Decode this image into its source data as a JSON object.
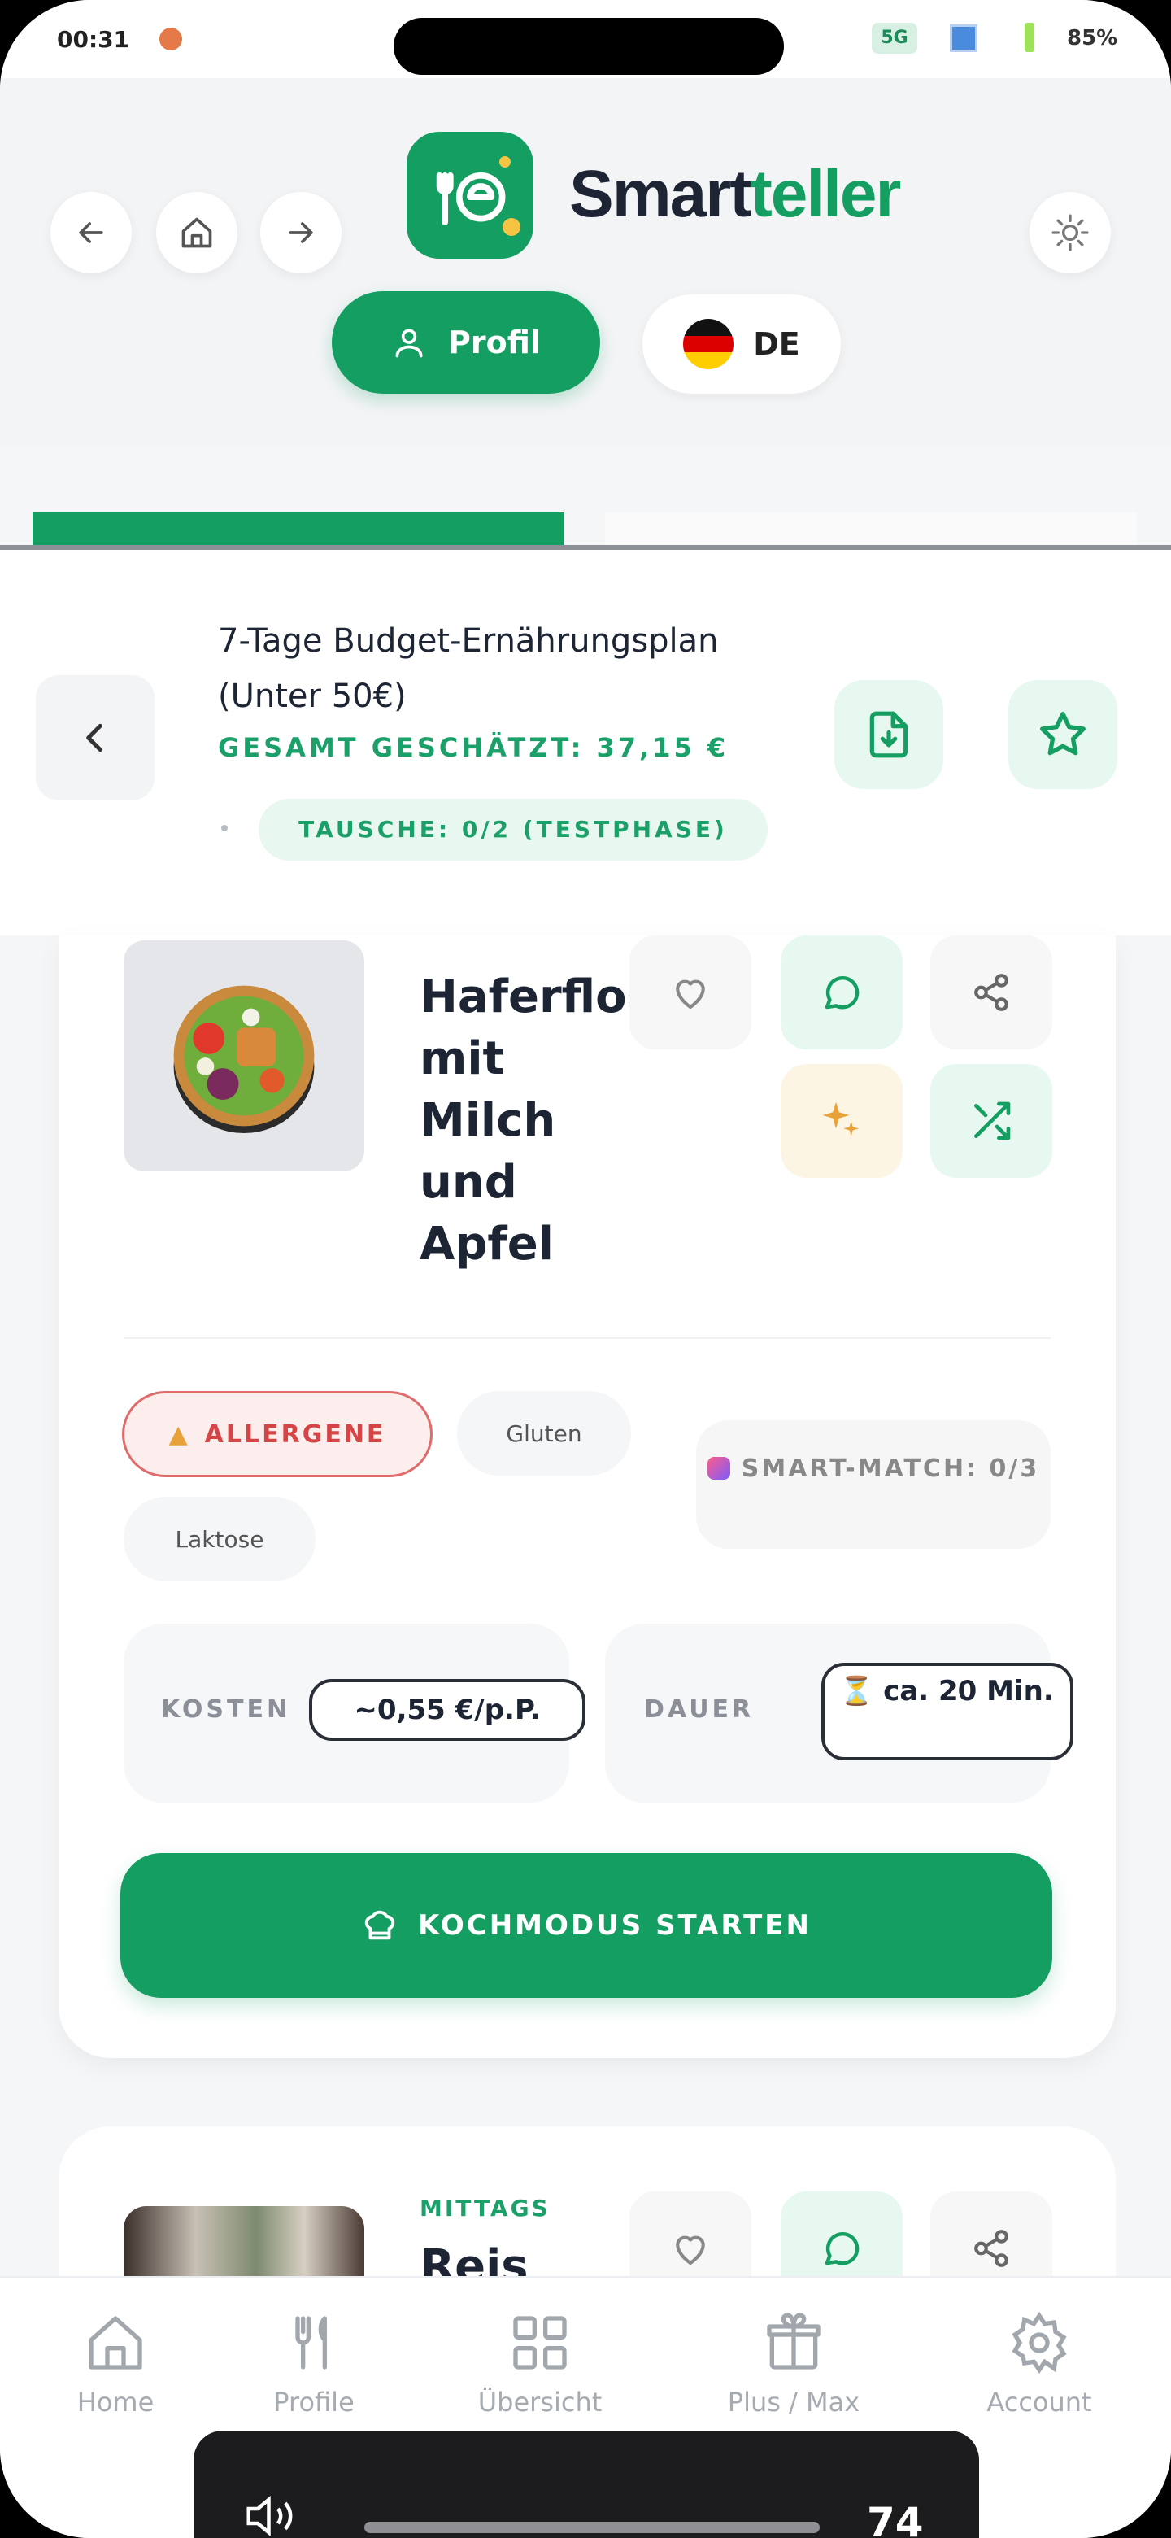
{
  "status_bar": {
    "time": "00:31",
    "network": "5G",
    "battery": "85%"
  },
  "header": {
    "brand_part1": "Smart",
    "brand_part2": "teller",
    "profile_label": "Profil",
    "language_label": "DE"
  },
  "plan": {
    "title": "7-Tage Budget-Ernährungsplan (Unter 50€)",
    "total": "GESAMT GESCHÄTZT: 37,15 €",
    "swaps": "TAUSCHE: 0/2 (TESTPHASE)"
  },
  "meal1": {
    "name": "Haferflocken\nmit\nMilch\nund\nApfel",
    "allergene_label": "ALLERGENE",
    "allergens": [
      "Gluten",
      "Laktose"
    ],
    "smart_match": "SMART-MATCH: 0/3",
    "cost_label": "KOSTEN",
    "cost_value": "~0,55 €/p.P.",
    "duration_label": "DAUER",
    "duration_value": "ca. 20 Min.",
    "cook_button": "KOCHMODUS STARTEN"
  },
  "meal2": {
    "category": "MITTAGS",
    "name": "Reis"
  },
  "nav": {
    "items": [
      "Home",
      "Profile",
      "Übersicht",
      "Plus / Max",
      "Account"
    ]
  },
  "volume": {
    "level": "74"
  },
  "colors": {
    "primary": "#149e62",
    "danger": "#d64545",
    "text": "#1d2534"
  }
}
